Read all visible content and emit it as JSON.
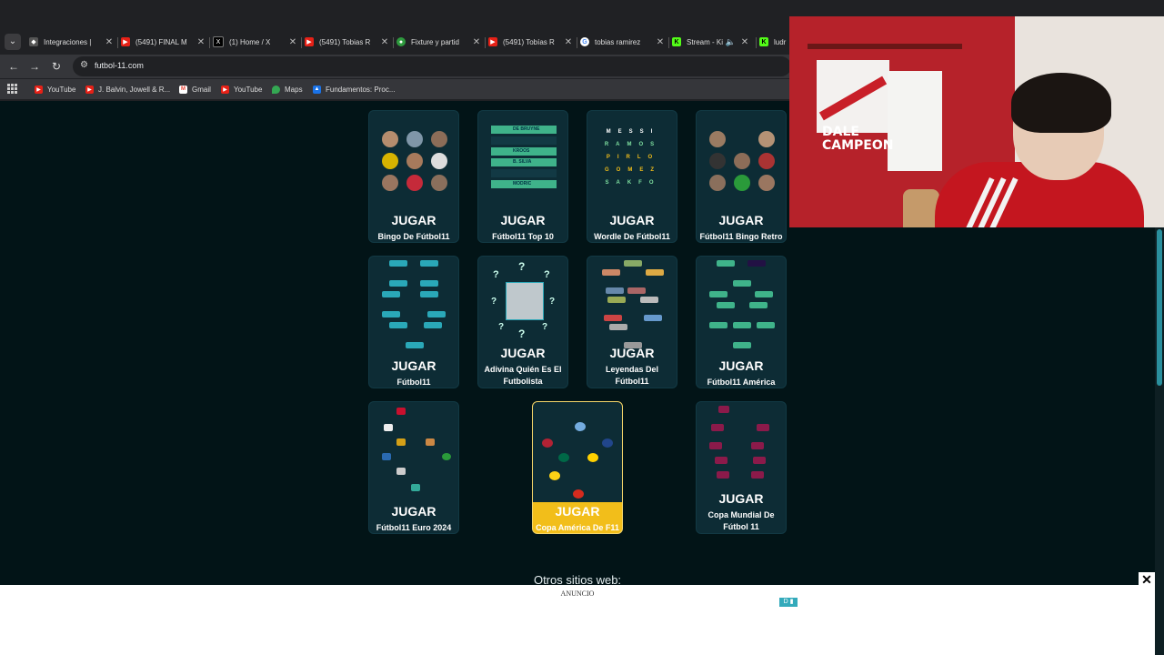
{
  "browser": {
    "tabs": [
      {
        "title": "Integraciones |",
        "icon": "app-icon",
        "color": "#555555"
      },
      {
        "title": "(5491) FINAL M",
        "icon": "youtube-icon",
        "color": "#e62117"
      },
      {
        "title": "(1) Home / X",
        "icon": "x-icon",
        "color": "#000000"
      },
      {
        "title": "(5491) Tobias R",
        "icon": "youtube-icon",
        "color": "#e62117"
      },
      {
        "title": "Fixture y partid",
        "icon": "soccer-ball-icon",
        "color": "#2e9a3e"
      },
      {
        "title": "(5491) Tobías R",
        "icon": "youtube-icon",
        "color": "#e62117"
      },
      {
        "title": "tobias ramirez",
        "icon": "google-icon",
        "color": "#4285f4"
      },
      {
        "title": "Stream - Ki",
        "icon": "kick-icon",
        "color": "#53fc18"
      },
      {
        "title": "ludr",
        "icon": "kick-icon",
        "color": "#53fc18"
      }
    ],
    "url": "futbol-11.com",
    "bookmarks": [
      {
        "label": "YouTube",
        "icon": "youtube-icon",
        "color": "#e62117"
      },
      {
        "label": "J. Balvin, Jowell & R...",
        "icon": "youtube-icon",
        "color": "#e62117"
      },
      {
        "label": "Gmail",
        "icon": "gmail-icon",
        "color": "#ea4335"
      },
      {
        "label": "YouTube",
        "icon": "youtube-icon",
        "color": "#e62117"
      },
      {
        "label": "Maps",
        "icon": "maps-pin-icon",
        "color": "#34a853"
      },
      {
        "label": "Fundamentos: Proc...",
        "icon": "drive-icon",
        "color": "#1a73e8"
      }
    ]
  },
  "play_label": "JUGAR",
  "games": [
    {
      "name": "Bingo De Fútbol11"
    },
    {
      "name": "Fútbol11 Top 10",
      "list": [
        "DE BRUYNE",
        "",
        "KROOS",
        "B. SILVA",
        "",
        "MODRIC"
      ]
    },
    {
      "name": "Wordle De Fútbol11",
      "words": [
        "MESSI",
        "RAMOS",
        "PIRLO",
        "GOMEZ",
        "SAKFO"
      ]
    },
    {
      "name": "Fútbol11 Bingo Retro"
    },
    {
      "name": "Fútbol11"
    },
    {
      "name": "Adivina Quién Es El Futbolista"
    },
    {
      "name": "Leyendas Del Fútbol11"
    },
    {
      "name": "Fútbol11 América"
    },
    {
      "name": "Fútbol11 Euro 2024"
    },
    {
      "name": "Copa América De F11",
      "featured": true
    },
    {
      "name": "Copa Mundial De Fútbol 11"
    }
  ],
  "other_sites_title": "Otros sitios web:",
  "ad": {
    "label": "ANUNCIO",
    "close": "✕",
    "choice": "D ▮"
  },
  "webcam": {
    "banner_text": "DALE\nCAMPEON",
    "colors": {
      "red": "#c4161f",
      "white": "#f3f1ef"
    }
  },
  "colors": {
    "page_bg": "#021417",
    "card_bg": "#0d2c35",
    "featured": "#f2be1a",
    "pill_green": "#3fb38a",
    "pill_teal": "#2aa8b8"
  }
}
